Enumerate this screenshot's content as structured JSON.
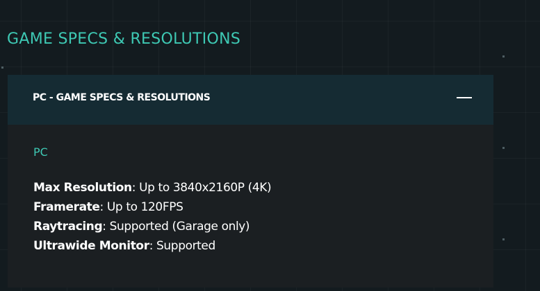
{
  "page": {
    "title": "GAME SPECS & RESOLUTIONS"
  },
  "accordion": {
    "header": "PC - GAME SPECS & RESOLUTIONS",
    "expanded": true,
    "toggle_icon": "minus-icon",
    "platform": "PC",
    "specs": [
      {
        "name": "Max Resolution",
        "value": "Up to 3840x2160P (4K)"
      },
      {
        "name": "Framerate",
        "value": "Up to 120FPS"
      },
      {
        "name": "Raytracing",
        "value": "Supported (Garage only)"
      },
      {
        "name": "Ultrawide Monitor",
        "value": "Supported"
      }
    ]
  },
  "colors": {
    "accent": "#3ec9b4",
    "background": "#131b1f",
    "header_background": "#152b33",
    "panel_background": "#1b1f22",
    "text": "#ffffff"
  }
}
